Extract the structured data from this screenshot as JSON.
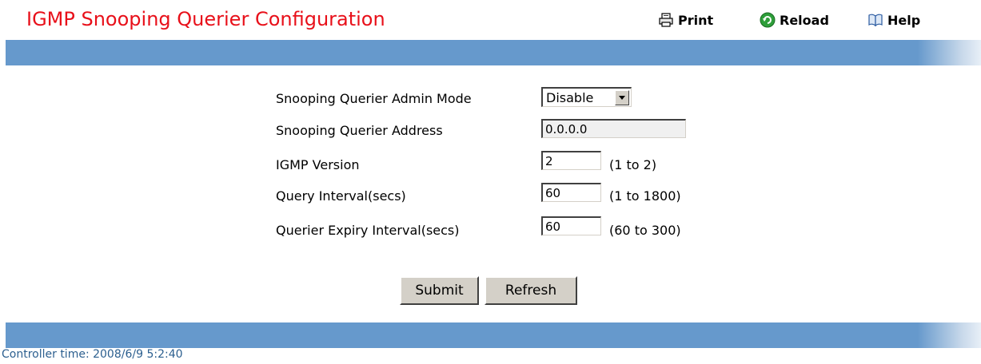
{
  "header": {
    "title": "IGMP Snooping Querier Configuration",
    "print_label": "Print",
    "reload_label": "Reload",
    "help_label": "Help",
    "title_color": "#e8101a",
    "bar_color": "#6699cc"
  },
  "form": {
    "admin_mode": {
      "label": "Snooping Querier Admin Mode",
      "value": "Disable"
    },
    "address": {
      "label": "Snooping Querier Address",
      "value": "0.0.0.0"
    },
    "igmp_version": {
      "label": "IGMP Version",
      "value": "2",
      "range": "(1 to 2)"
    },
    "query_interval": {
      "label": "Query Interval(secs)",
      "value": "60",
      "range": "(1 to 1800)"
    },
    "expiry_interval": {
      "label": "Querier Expiry Interval(secs)",
      "value": "60",
      "range": "(60 to 300)"
    }
  },
  "buttons": {
    "submit_label": "Submit",
    "refresh_label": "Refresh"
  },
  "footer": {
    "controller_time": "Controller time: 2008/6/9 5:2:40"
  }
}
